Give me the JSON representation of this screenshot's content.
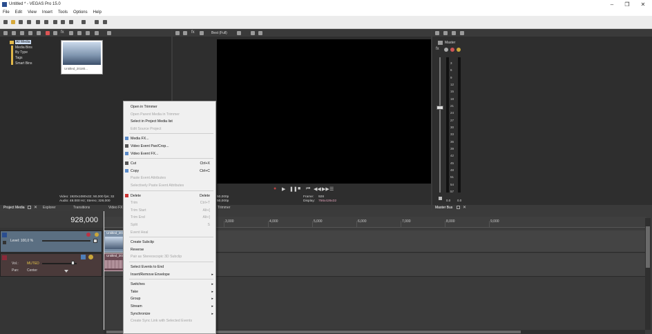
{
  "window": {
    "title": "Untitled * - VEGAS Pro 15.0",
    "min": "–",
    "max": "❐",
    "close": "✕"
  },
  "menubar": [
    "File",
    "Edit",
    "View",
    "Insert",
    "Tools",
    "Options",
    "Help"
  ],
  "media_panel": {
    "tree": [
      "All Media",
      "Media Bins",
      "By Type",
      "Tags",
      "Smart Bins"
    ],
    "thumb_caption": "Untitled_20180...",
    "info_line1": "Video: 1920x1080x32; 50,000 fps; 32",
    "info_line2": "Audio: 48.000 Hz; Stereo; 328,000"
  },
  "bottom_tabs": [
    "Project Media",
    "Explorer",
    "Transitions",
    "Video FX"
  ],
  "preview": {
    "quality": "Best (Full)",
    "frame_label": "Frame:",
    "frame_value": "928",
    "display_label": "Display:",
    "display_value": "756x426x32",
    "left_val1": "50,000p",
    "left_val2": "50,000p",
    "trimmer_tab": "Trimmer"
  },
  "master": {
    "label": "Master",
    "scale": [
      "3",
      "6",
      "9",
      "12",
      "15",
      "18",
      "21",
      "24",
      "27",
      "30",
      "33",
      "36",
      "39",
      "42",
      "45",
      "48",
      "51",
      "54",
      "57"
    ],
    "bottom_left": "0.0",
    "bottom_right": "0.0",
    "tab": "Master Bus"
  },
  "timeline": {
    "timecode": "928,000",
    "video_track": {
      "level": "Level: 100,0 %",
      "clip": "Untitled_20180..."
    },
    "audio_track": {
      "vol_label": "Vol.:",
      "vol_value": "MUTED",
      "pan_label": "Pan:",
      "pan_value": "Center",
      "clip": "Untitled_20180..."
    },
    "ruler": [
      "1,000",
      "2,000",
      "3,000",
      "4,000",
      "5,000",
      "6,000",
      "7,000",
      "8,000",
      "9,000"
    ]
  },
  "context_menu": {
    "items": [
      {
        "label": "Open in Trimmer",
        "shortcut": "",
        "disabled": false,
        "icon": "",
        "sub": false,
        "sep_after": false
      },
      {
        "label": "Open Parent Media in Trimmer",
        "shortcut": "",
        "disabled": true,
        "icon": "",
        "sub": false,
        "sep_after": false
      },
      {
        "label": "Select in Project Media list",
        "shortcut": "",
        "disabled": false,
        "icon": "",
        "sub": false,
        "sep_after": false
      },
      {
        "label": "Edit Source Project",
        "shortcut": "",
        "disabled": true,
        "icon": "",
        "sub": false,
        "sep_after": true
      },
      {
        "label": "Media FX...",
        "shortcut": "",
        "disabled": false,
        "icon": "fx-icon",
        "sub": false,
        "sep_after": false
      },
      {
        "label": "Video Event Pan/Crop...",
        "shortcut": "",
        "disabled": false,
        "icon": "pan-crop-icon",
        "sub": false,
        "sep_after": false
      },
      {
        "label": "Video Event FX...",
        "shortcut": "",
        "disabled": false,
        "icon": "event-fx-icon",
        "sub": false,
        "sep_after": true
      },
      {
        "label": "Cut",
        "shortcut": "Ctrl+X",
        "disabled": false,
        "icon": "cut-icon",
        "sub": false,
        "sep_after": false
      },
      {
        "label": "Copy",
        "shortcut": "Ctrl+C",
        "disabled": false,
        "icon": "copy-icon",
        "sub": false,
        "sep_after": false
      },
      {
        "label": "Paste Event Attributes",
        "shortcut": "",
        "disabled": true,
        "icon": "",
        "sub": false,
        "sep_after": false
      },
      {
        "label": "Selectively Paste Event Attributes",
        "shortcut": "",
        "disabled": true,
        "icon": "",
        "sub": false,
        "sep_after": true
      },
      {
        "label": "Delete",
        "shortcut": "Delete",
        "disabled": false,
        "icon": "delete-icon",
        "sub": false,
        "sep_after": false
      },
      {
        "label": "Trim",
        "shortcut": "Ctrl+T",
        "disabled": true,
        "icon": "",
        "sub": false,
        "sep_after": false
      },
      {
        "label": "Trim Start",
        "shortcut": "Alt+[",
        "disabled": true,
        "icon": "",
        "sub": false,
        "sep_after": false
      },
      {
        "label": "Trim End",
        "shortcut": "Alt+]",
        "disabled": true,
        "icon": "",
        "sub": false,
        "sep_after": false
      },
      {
        "label": "Split",
        "shortcut": "S",
        "disabled": true,
        "icon": "",
        "sub": false,
        "sep_after": false
      },
      {
        "label": "Event Heal",
        "shortcut": "",
        "disabled": true,
        "icon": "",
        "sub": false,
        "sep_after": true
      },
      {
        "label": "Create Subclip",
        "shortcut": "",
        "disabled": false,
        "icon": "",
        "sub": false,
        "sep_after": false
      },
      {
        "label": "Reverse",
        "shortcut": "",
        "disabled": false,
        "icon": "",
        "sub": false,
        "sep_after": false
      },
      {
        "label": "Pair as Stereoscopic 3D Subclip",
        "shortcut": "",
        "disabled": true,
        "icon": "",
        "sub": false,
        "sep_after": true
      },
      {
        "label": "Select Events to End",
        "shortcut": "",
        "disabled": false,
        "icon": "",
        "sub": false,
        "sep_after": false
      },
      {
        "label": "Insert/Remove Envelope",
        "shortcut": "",
        "disabled": false,
        "icon": "",
        "sub": true,
        "sep_after": true
      },
      {
        "label": "Switches",
        "shortcut": "",
        "disabled": false,
        "icon": "",
        "sub": true,
        "sep_after": false
      },
      {
        "label": "Take",
        "shortcut": "",
        "disabled": false,
        "icon": "",
        "sub": true,
        "sep_after": false
      },
      {
        "label": "Group",
        "shortcut": "",
        "disabled": false,
        "icon": "",
        "sub": true,
        "sep_after": false
      },
      {
        "label": "Stream",
        "shortcut": "",
        "disabled": false,
        "icon": "",
        "sub": true,
        "sep_after": false
      },
      {
        "label": "Synchronize",
        "shortcut": "",
        "disabled": false,
        "icon": "",
        "sub": true,
        "sep_after": false
      },
      {
        "label": "Create Sync Link with Selected Events",
        "shortcut": "",
        "disabled": true,
        "icon": "",
        "sub": false,
        "sep_after": false
      }
    ]
  }
}
